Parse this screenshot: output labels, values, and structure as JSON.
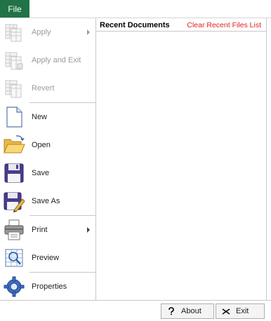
{
  "tab": {
    "file": "File"
  },
  "menu": {
    "apply": "Apply",
    "apply_exit": "Apply and Exit",
    "revert": "Revert",
    "new": "New",
    "open": "Open",
    "save": "Save",
    "save_as": "Save As",
    "print": "Print",
    "preview": "Preview",
    "properties": "Properties"
  },
  "recent": {
    "title": "Recent Documents",
    "clear": "Clear Recent Files List"
  },
  "footer": {
    "about": "About",
    "exit": "Exit"
  },
  "colors": {
    "accent": "#217346",
    "clear_link": "#e02020"
  }
}
